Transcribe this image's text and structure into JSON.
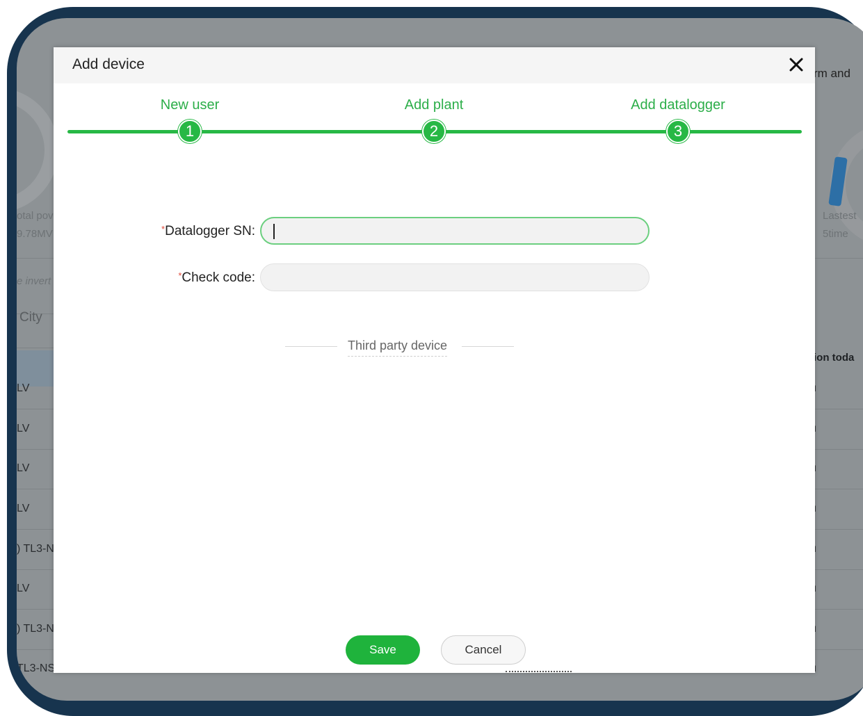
{
  "background": {
    "top_right_text": "rm and",
    "left_total_label": "otal pov",
    "left_total_value": "9.78MV",
    "right_label": "Lastest",
    "right_value": "5time",
    "left_inverter_label": "e invert",
    "city_label": "City",
    "column_header_right": "ion toda",
    "rows_left": [
      "LV",
      "LV",
      "LV",
      "LV",
      ") TL3-N:",
      "LV",
      ") TL3-N:",
      "TL3-NS"
    ],
    "rows_right_marks": [
      "ı",
      "ı",
      "ı",
      "ı",
      "ı",
      "ı",
      "ı",
      "ı"
    ]
  },
  "modal": {
    "title": "Add device",
    "close_icon": "close-icon",
    "accent_color": "#27b845"
  },
  "stepper": {
    "steps": [
      {
        "label": "New user",
        "number": "1"
      },
      {
        "label": "Add plant",
        "number": "2"
      },
      {
        "label": "Add datalogger",
        "number": "3"
      }
    ]
  },
  "form": {
    "datalogger_sn": {
      "required_mark": "*",
      "label": "Datalogger SN:",
      "value": ""
    },
    "check_code": {
      "required_mark": "*",
      "label": "Check code:",
      "value": ""
    },
    "third_party_link": "Third party device"
  },
  "actions": {
    "save_label": "Save",
    "cancel_label": "Cancel"
  }
}
